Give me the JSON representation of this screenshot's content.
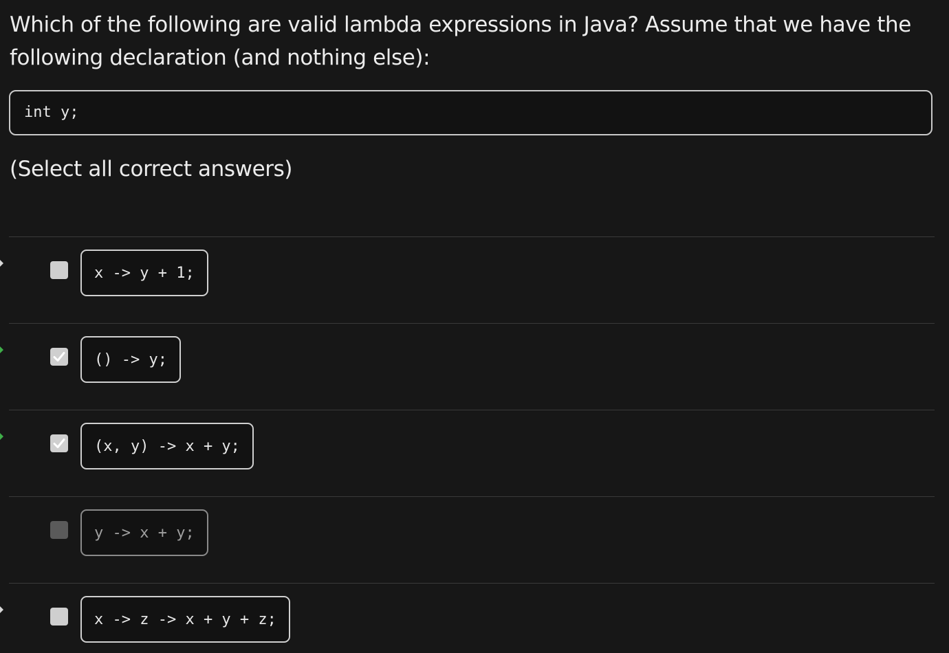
{
  "question": {
    "text": "Which of the following are valid lambda expressions in Java?  Assume that we have the following declaration (and nothing else):",
    "declaration": "int y;",
    "instruction": "(Select all correct answers)"
  },
  "answers": [
    {
      "code": "x -> y + 1;",
      "checked": false,
      "disabled": false,
      "marker": "white"
    },
    {
      "code": "() -> y;",
      "checked": true,
      "disabled": false,
      "marker": "green"
    },
    {
      "code": "(x, y) -> x + y;",
      "checked": true,
      "disabled": false,
      "marker": "green"
    },
    {
      "code": "y -> x + y;",
      "checked": false,
      "disabled": true,
      "marker": "none"
    },
    {
      "code": "x -> z -> x + y + z;",
      "checked": false,
      "disabled": false,
      "marker": "white"
    }
  ],
  "icons": {
    "check": "check-icon"
  }
}
